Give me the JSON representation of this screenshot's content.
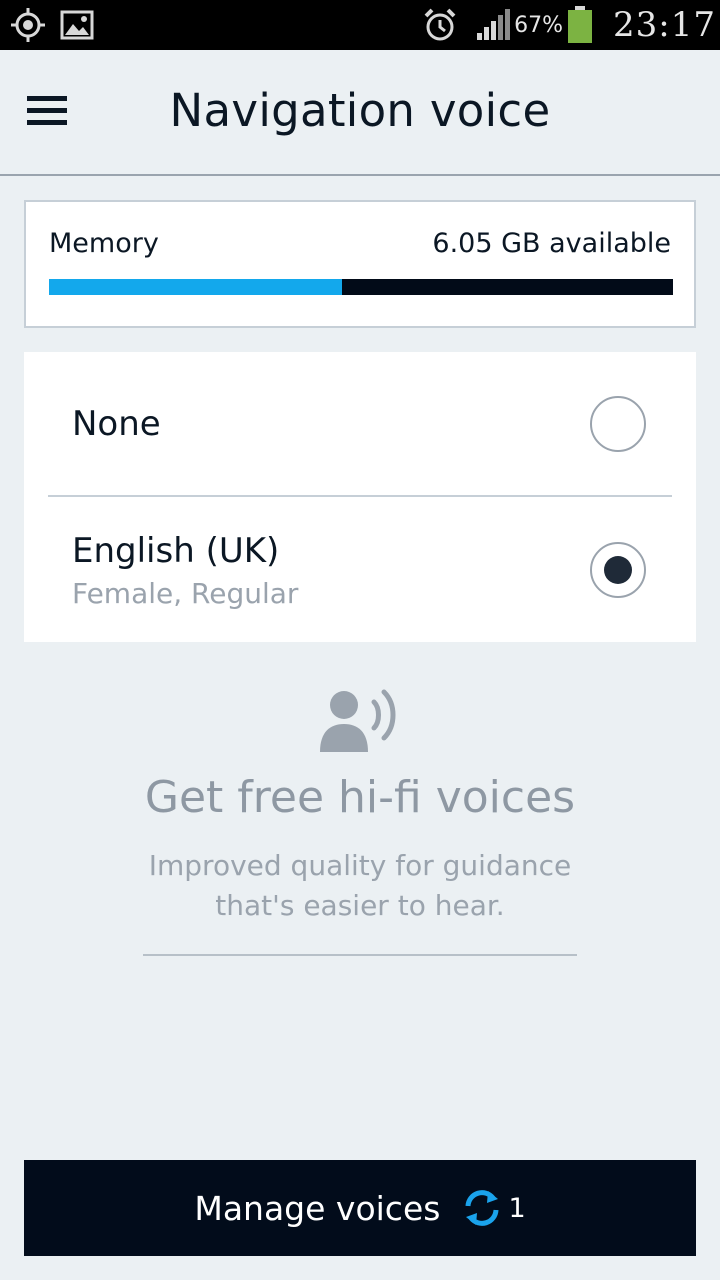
{
  "status_bar": {
    "left_icons": [
      "gps-icon",
      "image-icon"
    ],
    "right_icons": [
      "alarm-icon",
      "signal-icon",
      "battery-icon"
    ],
    "battery_percent": "67%",
    "time": "23:17",
    "battery_color": "#7cb342"
  },
  "header": {
    "menu_icon": "hamburger-menu-icon",
    "title": "Navigation voice"
  },
  "memory": {
    "label": "Memory",
    "available": "6.05 GB available",
    "used_fraction": 0.47,
    "fill_color": "#13a8ec",
    "track_color": "#020b18"
  },
  "voices": [
    {
      "name": "None",
      "detail": "",
      "selected": false
    },
    {
      "name": "English (UK)",
      "detail": "Female, Regular",
      "selected": true
    }
  ],
  "promo": {
    "icon": "speaking-person-icon",
    "title": "Get free hi-fi voices",
    "description_line1": "Improved quality for guidance",
    "description_line2": "that's easier to hear."
  },
  "manage_button": {
    "label": "Manage voices",
    "icon": "sync-icon",
    "count": "1",
    "icon_color": "#1aa3ec"
  }
}
